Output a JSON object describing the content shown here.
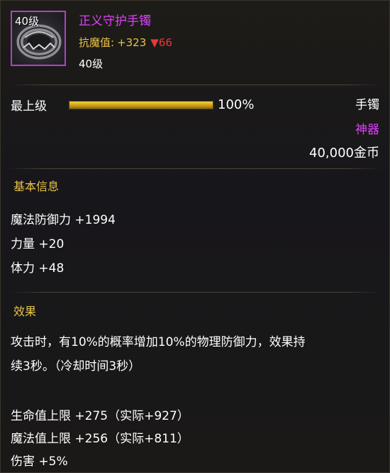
{
  "item": {
    "icon_level": "40级",
    "name": "正义守护手镯",
    "resist_label": "抗魔值:",
    "resist_value": "+323",
    "resist_delta": "▼66",
    "required_level": "40级",
    "icon": "bracelet-icon"
  },
  "grade": {
    "label": "最上级",
    "percent_text": "100%",
    "fill_fraction": 1.0
  },
  "info_right": {
    "slot": "手镯",
    "rarity": "神器",
    "price": "40,000金币"
  },
  "basic_info": {
    "title": "基本信息",
    "stats": [
      "魔法防御力 +1994",
      "力量 +20",
      "体力 +48"
    ]
  },
  "effect": {
    "title": "效果",
    "line1": "攻击时，有10%的概率增加10%的物理防御力，效果持",
    "line2": "续3秒。（冷却时间3秒）",
    "bonuses": [
      "生命值上限 +275（实际+927）",
      "魔法值上限 +256（实际+811）",
      "伤害 +5%"
    ]
  },
  "colors": {
    "name": "#e040ff",
    "gold": "#e8c34a",
    "decrease": "#e53a3a",
    "text": "#ffffff"
  }
}
